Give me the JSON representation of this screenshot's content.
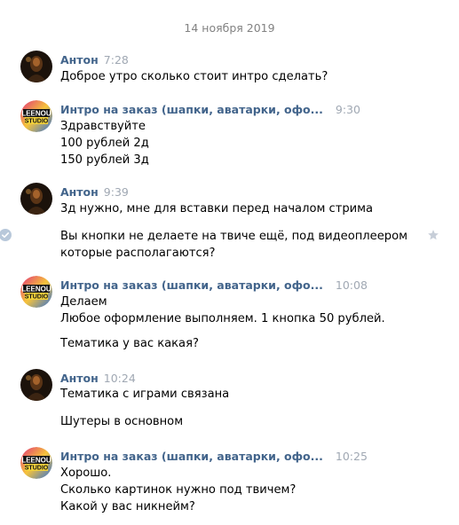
{
  "date_divider": "14 ноября 2019",
  "messages": [
    {
      "sender": "Антон",
      "time": "7:28",
      "lines": [
        "Доброе утро сколько стоит интро сделать?"
      ]
    },
    {
      "sender": "Интро на заказ (шапки, аватарки, офо...",
      "time": "9:30",
      "lines": [
        "Здравствуйте",
        "100 рублей 2д",
        "150 рублей 3д"
      ]
    },
    {
      "sender": "Антон",
      "time": "9:39",
      "lines": [
        "3д нужно, мне для вставки перед началом стрима"
      ],
      "lines2": [
        "Вы кнопки не делаете на твиче ещё, под видеоплеером",
        "которые располагаются?"
      ]
    },
    {
      "sender": "Интро на заказ (шапки, аватарки, офо...",
      "time": "10:08",
      "lines": [
        "Делаем",
        "Любое оформление выполняем. 1 кнопка 50 рублей."
      ],
      "lines2": [
        "Тематика у вас какая?"
      ]
    },
    {
      "sender": "Антон",
      "time": "10:24",
      "lines": [
        "Тематика с играми связана"
      ],
      "lines2": [
        "Шутеры в основном"
      ]
    },
    {
      "sender": "Интро на заказ (шапки, аватарки, офо...",
      "time": "10:25",
      "lines": [
        "Хорошо.",
        "Сколько картинок нужно под твичем?",
        "Какой у вас никнейм?"
      ]
    }
  ],
  "avatar_logo": {
    "line1": "LEENOU",
    "line2": "STUDIO"
  },
  "icons": {
    "read": "check-circle-icon",
    "star": "star-icon"
  },
  "colors": {
    "sender_name": "#42648b",
    "time": "#a0a8b3",
    "date": "#828282"
  }
}
